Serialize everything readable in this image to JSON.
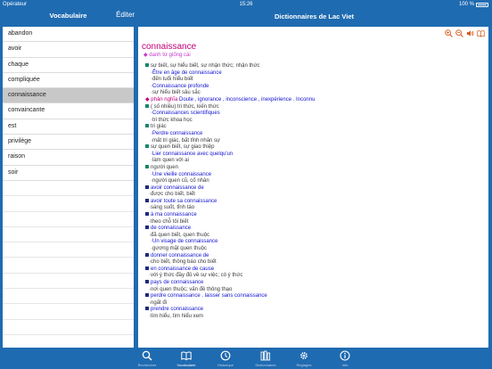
{
  "status": {
    "carrier": "Opérateur",
    "time": "15:26",
    "battery": "100 %"
  },
  "left": {
    "title": "Vocabulaire",
    "edit_label": "Éditer"
  },
  "right": {
    "title": "Dictionnaires de Lac Viet"
  },
  "words": [
    {
      "label": "abandon"
    },
    {
      "label": "avoir"
    },
    {
      "label": "chaque"
    },
    {
      "label": "compliquée"
    },
    {
      "label": "connaissance",
      "selected": true
    },
    {
      "label": "convaincante"
    },
    {
      "label": "est"
    },
    {
      "label": "privilège"
    },
    {
      "label": "raison"
    },
    {
      "label": "soir"
    }
  ],
  "entry": {
    "headword": "connaissance",
    "pos": "danh từ giống cái",
    "l1": "sự biết, sự hiểu biết, sự nhận thức; nhận thức",
    "l2": "Être en âge de connaissance",
    "l3": "đến tuổi hiểu biết",
    "l4": "Connaissance profonde",
    "l5": "sự hiểu biết sâu sắc",
    "l6_label": "phản nghĩa",
    "l6_words": "Doute , ignorance , inconscience , inexpérience . Inconnu",
    "l7": "( số nhiều) tri thức, kiến thức",
    "l8": "Connaissances scientifiques",
    "l9": "tri thức khoa học",
    "l10": "tri giác",
    "l11": "Perdre connaissance",
    "l12": "mất tri giác, bất tỉnh nhân sự",
    "l13": "sự quen biết, sự giao thiệp",
    "l14": "Lier connaissance avec quelqu'un",
    "l15": "làm quen với ai",
    "l16": "người quen",
    "l17": "Une vieille connaissance",
    "l18": "người quen cũ, cố nhân",
    "l19": "avoir connaissance de",
    "l20": "được cho biết, biết",
    "l21": "avoir toute sa connaissance",
    "l22": "sáng suốt, tỉnh táo",
    "l23": "à ma connaissance",
    "l24": "theo chỗ tôi biết",
    "l25": "de connaissance",
    "l26": "đã quen biết, quen thuộc",
    "l27": "Un visage de connaissance",
    "l28": "gương mặt quen thuộc",
    "l29": "donner connaissance de",
    "l30": "cho biết, thông báo cho biết",
    "l31": "en connaissance de cause",
    "l32": "với ý thức đầy đủ về sự việc; có ý thức",
    "l33": "pays de connaissance",
    "l34": "nơi quen thuộc; vấn đề thông thạo",
    "l35": "perdre connaissance . laisser sans connaissance",
    "l36": "ngất đi",
    "l37": "prendre connaissance",
    "l38": "tìm hiểu, tìm hiểu xem"
  },
  "tabs": [
    {
      "label": "Rechercher",
      "icon": "search-icon"
    },
    {
      "label": "Vocabulaire",
      "icon": "book-icon"
    },
    {
      "label": "Historique",
      "icon": "history-icon"
    },
    {
      "label": "Dictionnaires",
      "icon": "dictionaries-icon"
    },
    {
      "label": "Réglages",
      "icon": "gear-icon"
    },
    {
      "label": "Info",
      "icon": "info-icon"
    }
  ],
  "colors": {
    "brand": "#1f6bb1",
    "headword": "#c1007a",
    "english": "#1212d1",
    "tool": "#d4581c"
  }
}
